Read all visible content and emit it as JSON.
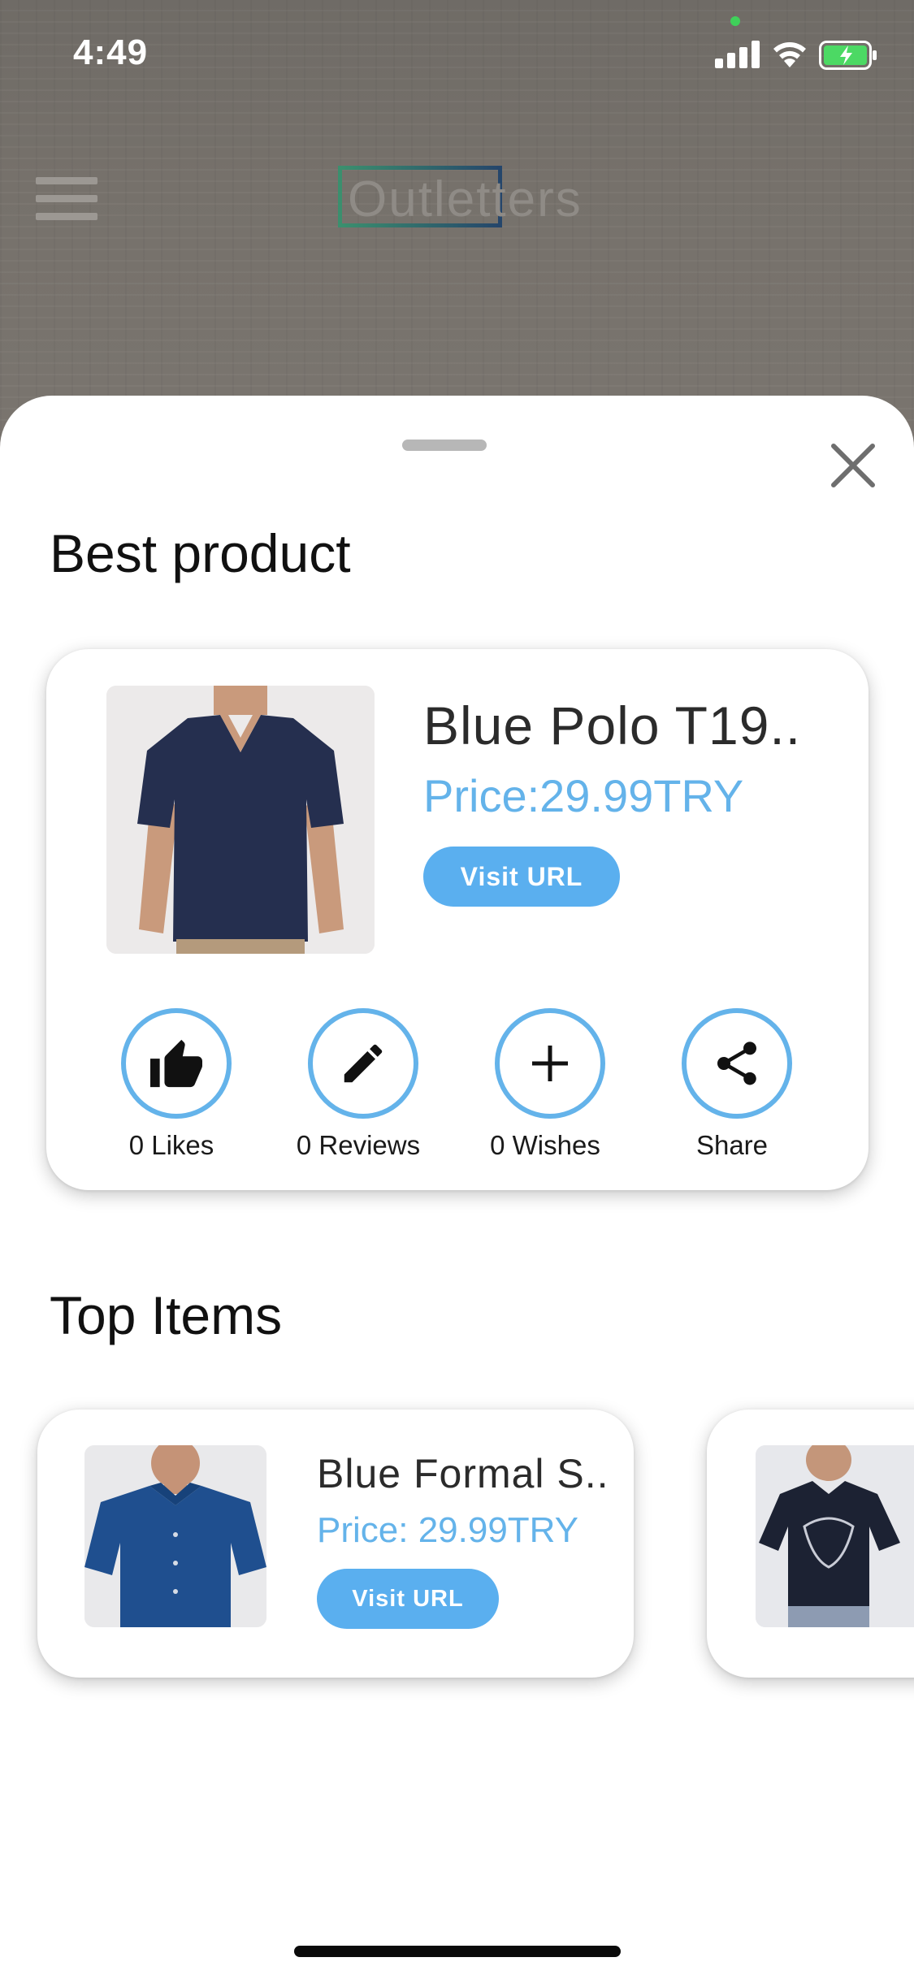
{
  "status_bar": {
    "time": "4:49"
  },
  "background_app": {
    "logo_text": "Outletters"
  },
  "sheet": {
    "best_section_title": "Best product",
    "best_product": {
      "name": "Blue Polo T19..",
      "price": "Price:29.99TRY",
      "visit_label": "Visit URL",
      "actions": [
        {
          "label": "0 Likes",
          "icon": "thumbs-up-icon"
        },
        {
          "label": "0 Reviews",
          "icon": "pencil-icon"
        },
        {
          "label": "0 Wishes",
          "icon": "plus-icon"
        },
        {
          "label": "Share",
          "icon": "share-icon"
        }
      ]
    },
    "top_section_title": "Top Items",
    "top_items": [
      {
        "name": "Blue Formal S..",
        "price": "Price: 29.99TRY",
        "visit_label": "Visit URL"
      }
    ]
  },
  "colors": {
    "accent": "#5aafef",
    "price_text": "#64b3ea",
    "circle_border": "#64b3ea"
  }
}
